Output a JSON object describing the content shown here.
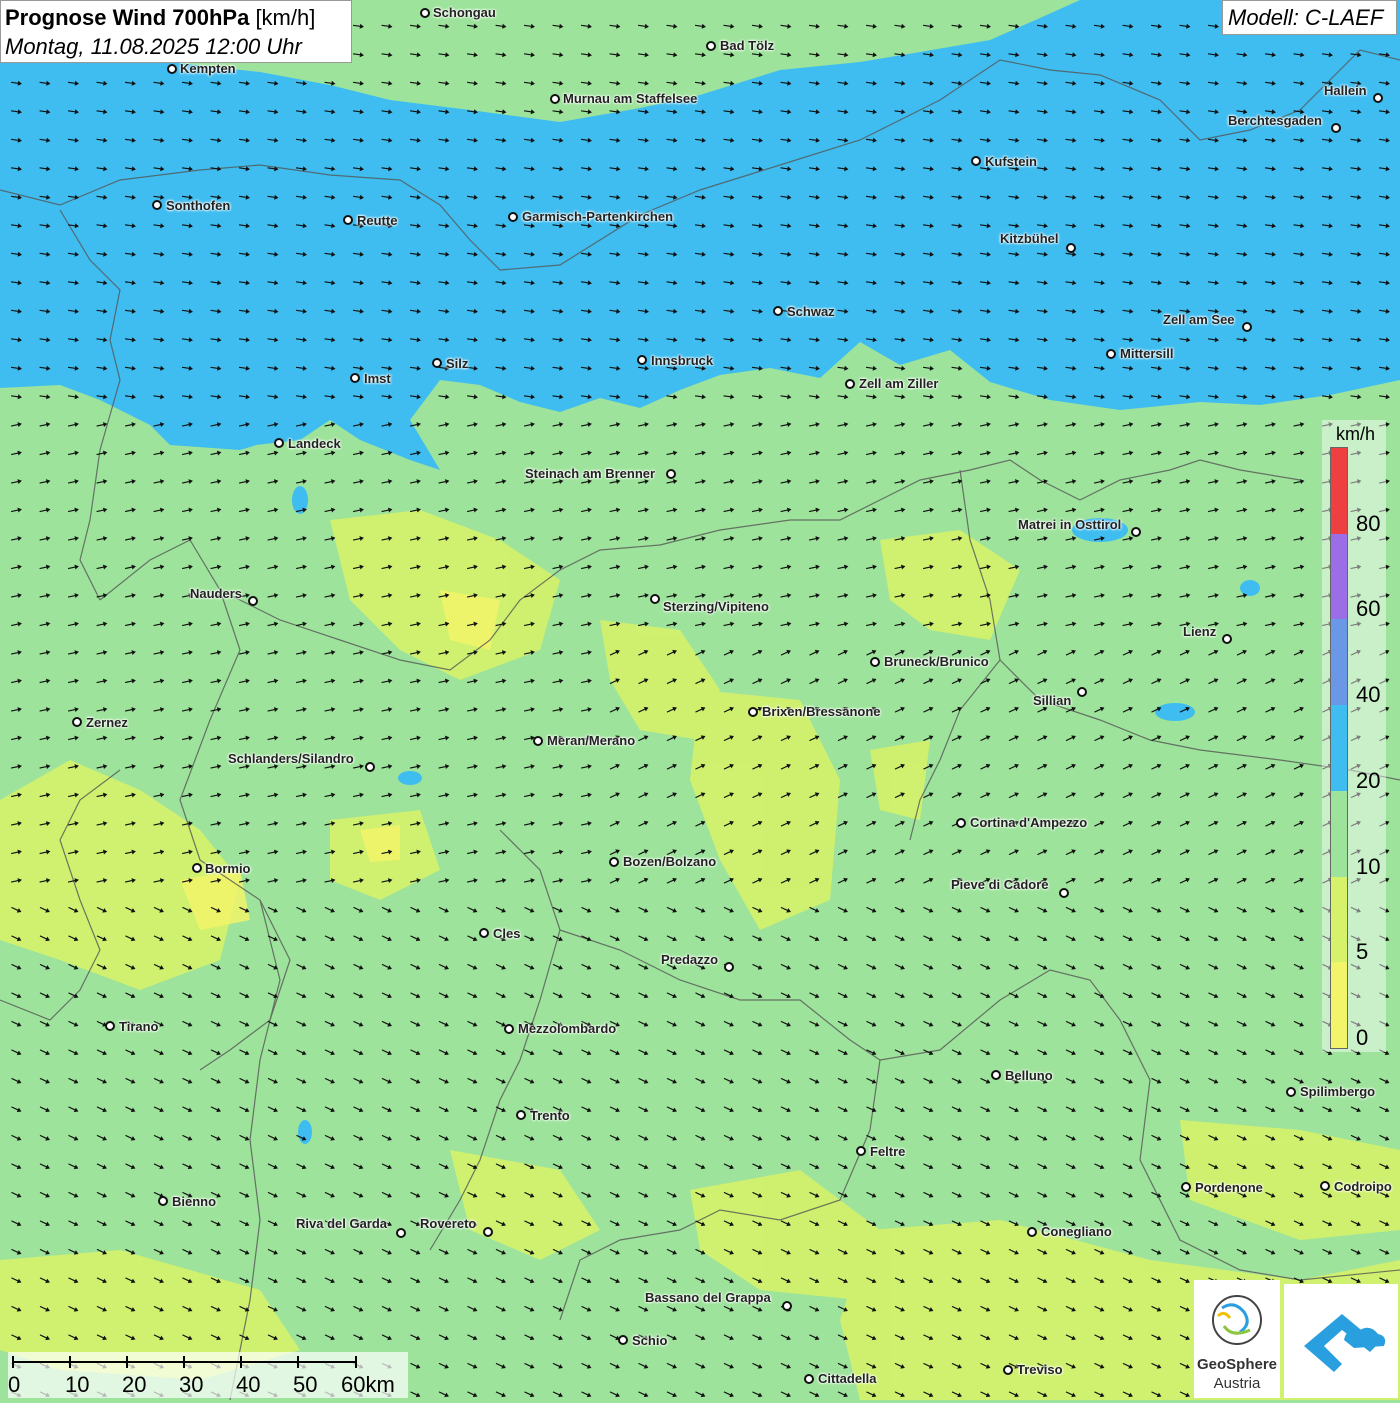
{
  "title": {
    "main": "Prognose Wind 700hPa",
    "unit": "[km/h]",
    "datetime": "Montag, 11.08.2025 12:00 Uhr"
  },
  "model": "Modell: C-LAEF",
  "legend": {
    "unit": "km/h",
    "bands": [
      {
        "from": 0,
        "to": 5,
        "color": "#f2f56a"
      },
      {
        "from": 5,
        "to": 10,
        "color": "#d5f26a"
      },
      {
        "from": 10,
        "to": 20,
        "color": "#9de39b"
      },
      {
        "from": 20,
        "to": 40,
        "color": "#3fbdf0"
      },
      {
        "from": 40,
        "to": 60,
        "color": "#6a97e6"
      },
      {
        "from": 60,
        "to": 80,
        "color": "#9b6ee8"
      },
      {
        "from": 80,
        "to": 100,
        "color": "#ee4040"
      }
    ],
    "labels": [
      "0",
      "5",
      "10",
      "20",
      "40",
      "60",
      "80"
    ]
  },
  "scale": {
    "labels": [
      "0",
      "10",
      "20",
      "30",
      "40",
      "50",
      "60km"
    ]
  },
  "logos": {
    "geosphere_name": "GeoSphere",
    "geosphere_sub": "Austria"
  },
  "cities": [
    {
      "name": "Schongau"
    },
    {
      "name": "Bad Tölz"
    },
    {
      "name": "Kempten"
    },
    {
      "name": "Murnau am Staffelsee"
    },
    {
      "name": "Hallein"
    },
    {
      "name": "Berchtesgaden"
    },
    {
      "name": "Kufstein"
    },
    {
      "name": "Sonthofen"
    },
    {
      "name": "Reutte"
    },
    {
      "name": "Garmisch-Partenkirchen"
    },
    {
      "name": "Kitzbühel"
    },
    {
      "name": "Schwaz"
    },
    {
      "name": "Zell am See"
    },
    {
      "name": "Mittersill"
    },
    {
      "name": "Innsbruck"
    },
    {
      "name": "Silz"
    },
    {
      "name": "Imst"
    },
    {
      "name": "Zell am Ziller"
    },
    {
      "name": "Landeck"
    },
    {
      "name": "Steinach am Brenner"
    },
    {
      "name": "Matrei in Osttirol"
    },
    {
      "name": "Nauders"
    },
    {
      "name": "Sterzing/Vipiteno"
    },
    {
      "name": "Lienz"
    },
    {
      "name": "Bruneck/Brunico"
    },
    {
      "name": "Sillian"
    },
    {
      "name": "Brixen/Bressanone"
    },
    {
      "name": "Zernez"
    },
    {
      "name": "Meran/Merano"
    },
    {
      "name": "Schlanders/Silandro"
    },
    {
      "name": "Cortina d'Ampezzo"
    },
    {
      "name": "Bozen/Bolzano"
    },
    {
      "name": "Bormio"
    },
    {
      "name": "Pieve di Cadore"
    },
    {
      "name": "Cles"
    },
    {
      "name": "Predazzo"
    },
    {
      "name": "Tirano"
    },
    {
      "name": "Mezzolombardo"
    },
    {
      "name": "Belluno"
    },
    {
      "name": "Spilimbergo"
    },
    {
      "name": "Trento"
    },
    {
      "name": "Feltre"
    },
    {
      "name": "Bienno"
    },
    {
      "name": "Pordenone"
    },
    {
      "name": "Codroipo"
    },
    {
      "name": "Riva del Garda"
    },
    {
      "name": "Rovereto"
    },
    {
      "name": "Conegliano"
    },
    {
      "name": "Bassano del Grappa"
    },
    {
      "name": "Schio"
    },
    {
      "name": "Cittadella"
    },
    {
      "name": "Treviso"
    }
  ],
  "colors": {
    "strong_wind": "#3fbdf0",
    "moderate_wind": "#9de39b",
    "light_wind": "#d5f26a",
    "calm": "#f2f56a",
    "arrow": "#111111",
    "border": "#555555"
  }
}
